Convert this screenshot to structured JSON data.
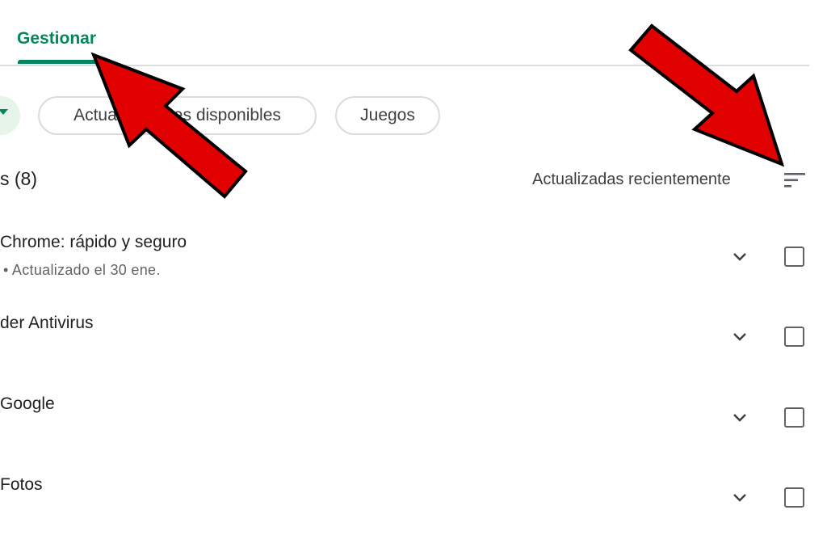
{
  "tabs": {
    "active_label": "Gestionar"
  },
  "filters": [
    {
      "label": "Actualizaciones disponibles"
    },
    {
      "label": "Juegos"
    }
  ],
  "list_header": {
    "count_label": "s (8)",
    "sort_label": "Actualizadas recientemente",
    "sort_icon": "sort-icon"
  },
  "apps": [
    {
      "name": "Chrome: rápido y seguro",
      "meta": "• Actualizado el 30 ene."
    },
    {
      "name": "der Antivirus",
      "meta": ""
    },
    {
      "name": "Google",
      "meta": ""
    },
    {
      "name": "Fotos",
      "meta": ""
    }
  ],
  "colors": {
    "accent": "#01875f",
    "annotation_arrow": "#e00000"
  }
}
